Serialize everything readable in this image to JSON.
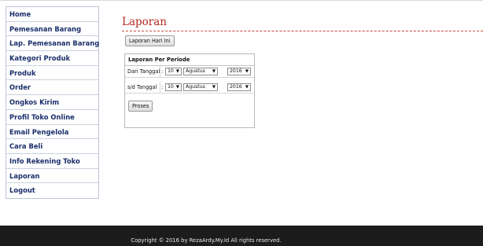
{
  "sidebar": {
    "items": [
      {
        "label": "Home"
      },
      {
        "label": "Pemesanan Barang"
      },
      {
        "label": "Lap. Pemesanan Barang"
      },
      {
        "label": "Kategori Produk"
      },
      {
        "label": "Produk"
      },
      {
        "label": "Order"
      },
      {
        "label": "Ongkos Kirim"
      },
      {
        "label": "Profil Toko Online"
      },
      {
        "label": "Email Pengelola"
      },
      {
        "label": "Cara Beli"
      },
      {
        "label": "Info Rekening Toko"
      },
      {
        "label": "Laporan"
      },
      {
        "label": "Logout"
      }
    ]
  },
  "main": {
    "title": "Laporan",
    "today_button": "Laporan Hari Ini",
    "period": {
      "heading": "Laporan Per Periode",
      "from_label": "Dari Tanggal",
      "to_label": "s/d Tanggal",
      "colon": ":",
      "from": {
        "day": "10",
        "month": "Agustus",
        "year": "2016"
      },
      "to": {
        "day": "10",
        "month": "Agustus",
        "year": "2016"
      },
      "submit": "Proses"
    }
  },
  "icons": {
    "dropdown": "▼"
  },
  "footer": {
    "text": "Copyright © 2016 by RezaArdy.My.Id All rights reserved."
  },
  "colors": {
    "title": "#b5251c",
    "nav_text": "#1a2f6b",
    "footer_bg": "#1c1c1c"
  }
}
